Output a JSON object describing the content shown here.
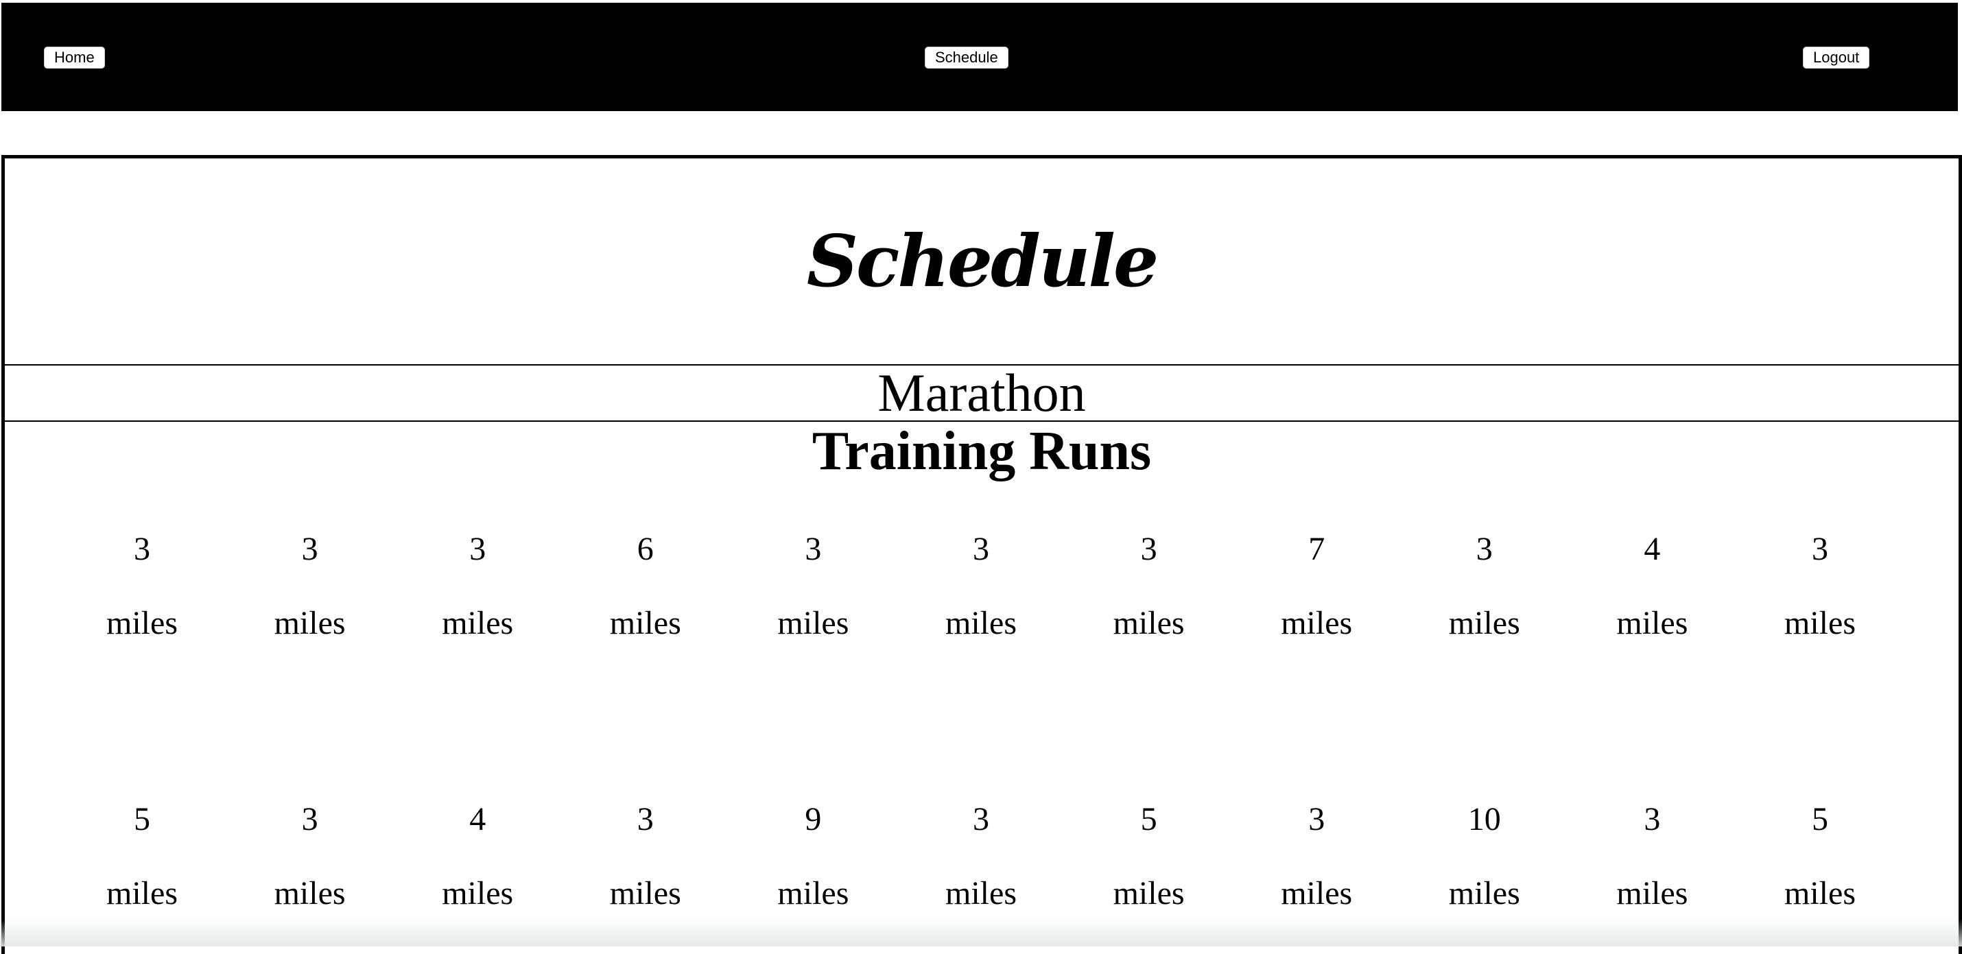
{
  "nav": {
    "home_label": "Home",
    "schedule_label": "Schedule",
    "logout_label": "Logout"
  },
  "page": {
    "title": "Schedule",
    "event_name": "Marathon",
    "section_heading": "Training Runs"
  },
  "training_runs": {
    "unit": "miles",
    "row_1": [
      "3",
      "3",
      "3",
      "6",
      "3",
      "3",
      "3",
      "7",
      "3",
      "4",
      "3"
    ],
    "row_2": [
      "5",
      "3",
      "4",
      "3",
      "9",
      "3",
      "5",
      "3",
      "10",
      "3",
      "5"
    ]
  }
}
